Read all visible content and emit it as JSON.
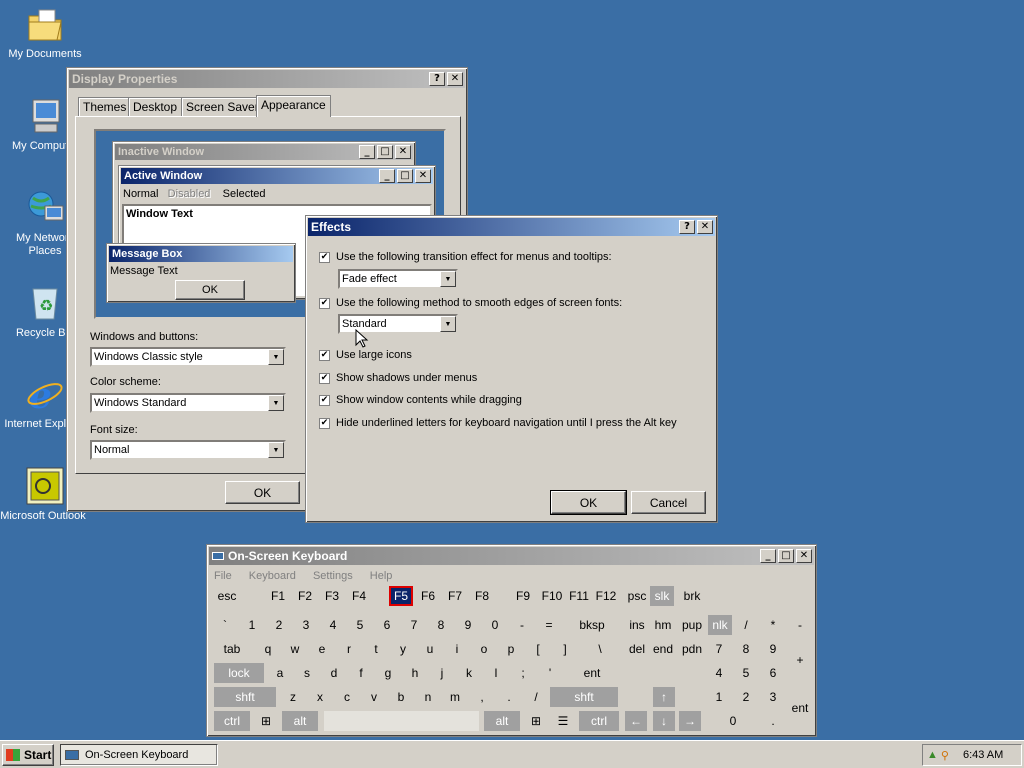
{
  "desktop": {
    "icons": [
      {
        "label": "My Documents",
        "icon": "folder-documents-icon"
      },
      {
        "label": "My Computer",
        "icon": "computer-icon"
      },
      {
        "label": "My Network Places",
        "icon": "network-places-icon"
      },
      {
        "label": "Recycle Bin",
        "icon": "recycle-bin-icon"
      },
      {
        "label": "Internet Explorer",
        "icon": "internet-explorer-icon"
      },
      {
        "label": "Microsoft Outlook",
        "icon": "outlook-icon"
      }
    ]
  },
  "display_properties": {
    "title": "Display Properties",
    "tabs": [
      "Themes",
      "Desktop",
      "Screen Saver",
      "Appearance"
    ],
    "active_tab": "Appearance",
    "preview": {
      "inactive_title": "Inactive Window",
      "active_title": "Active Window",
      "menu": [
        "Normal",
        "Disabled",
        "Selected"
      ],
      "window_text": "Window Text",
      "message_box_title": "Message Box",
      "message_text": "Message Text",
      "ok": "OK"
    },
    "windows_buttons_label": "Windows and buttons:",
    "windows_buttons_value": "Windows Classic style",
    "color_scheme_label": "Color scheme:",
    "color_scheme_value": "Windows Standard",
    "font_size_label": "Font size:",
    "font_size_value": "Normal",
    "ok": "OK"
  },
  "effects": {
    "title": "Effects",
    "options": [
      {
        "label": "Use the following transition effect for menus and tooltips:",
        "checked": true
      },
      {
        "label": "Use the following method to smooth edges of screen fonts:",
        "checked": true
      },
      {
        "label": "Use large icons",
        "checked": true
      },
      {
        "label": "Show shadows under menus",
        "checked": true
      },
      {
        "label": "Show window contents while dragging",
        "checked": true
      },
      {
        "label": "Hide underlined letters for keyboard navigation until I press the Alt key",
        "checked": true
      }
    ],
    "transition_value": "Fade effect",
    "smoothing_value": "Standard",
    "ok": "OK",
    "cancel": "Cancel"
  },
  "osk": {
    "title": "On-Screen Keyboard",
    "menu": [
      "File",
      "Keyboard",
      "Settings",
      "Help"
    ],
    "pressed_key": "F5"
  },
  "taskbar": {
    "start": "Start",
    "task": "On-Screen Keyboard",
    "clock": "6:43 AM"
  },
  "colors": {
    "desktop": "#3a6ea5",
    "title_active": "#0a246a",
    "face": "#d4d0c8"
  }
}
